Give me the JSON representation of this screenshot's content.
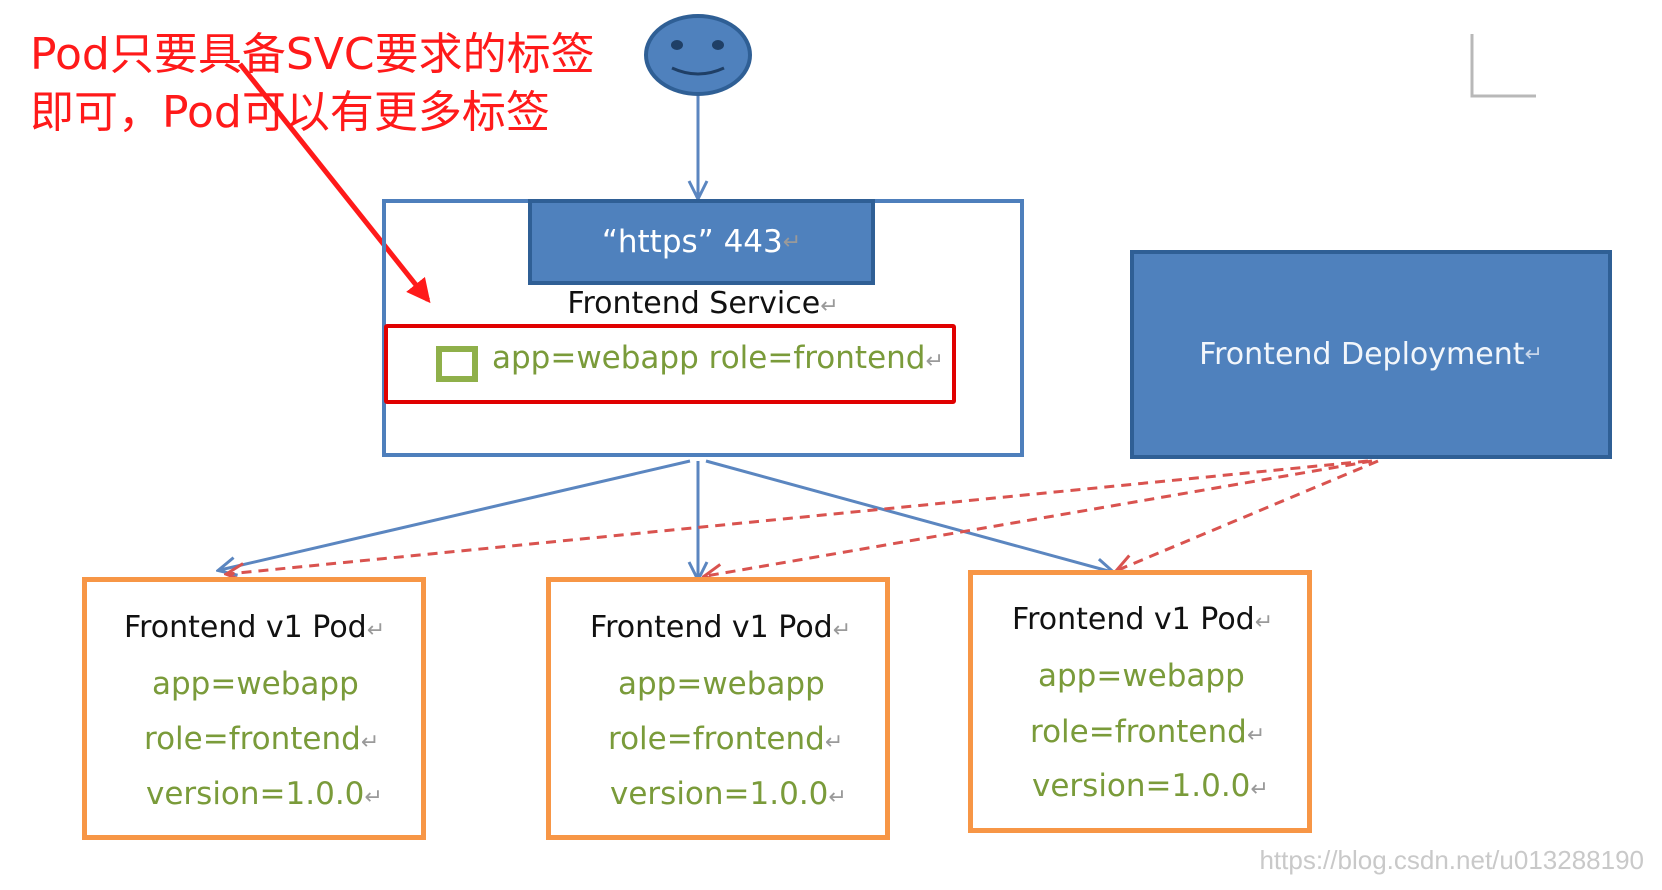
{
  "note": {
    "line1": "Pod只要具备SVC要求的标签",
    "line2": "即可，Pod可以有更多标签"
  },
  "service": {
    "port_label": "“https” 443",
    "title": "Frontend Service",
    "selector": "app=webapp role=frontend"
  },
  "deployment": {
    "title": "Frontend Deployment"
  },
  "pods": [
    {
      "title": "Frontend v1 Pod",
      "labels": [
        "app=webapp",
        "role=frontend",
        "version=1.0.0"
      ]
    },
    {
      "title": "Frontend v1 Pod",
      "labels": [
        "app=webapp",
        "role=frontend",
        "version=1.0.0"
      ]
    },
    {
      "title": "Frontend v1 Pod",
      "labels": [
        "app=webapp",
        "role=frontend",
        "version=1.0.0"
      ]
    }
  ],
  "return_mark": "↵",
  "watermark": "https://blog.csdn.net/u013288190",
  "colors": {
    "annotation": "#ff1a1a",
    "service_border": "#4e7fbc",
    "box_fill": "#4f81bd",
    "pod_border": "#f79646",
    "label_green": "#7a9b3a",
    "dashed_line": "#d9534f"
  },
  "icons": [
    "user-face-icon",
    "selector-square-icon"
  ]
}
